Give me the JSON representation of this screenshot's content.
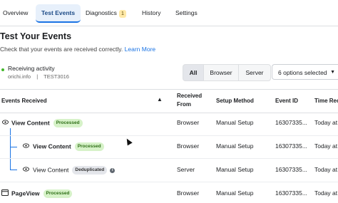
{
  "tabs": [
    {
      "label": "Overview"
    },
    {
      "label": "Test Events"
    },
    {
      "label": "Diagnostics",
      "badge": "1"
    },
    {
      "label": "History"
    },
    {
      "label": "Settings"
    }
  ],
  "page": {
    "title": "Test Your Events",
    "subtitle": "Check that your events are received correctly.",
    "learn_more": "Learn More"
  },
  "status": {
    "label": "Receiving activity",
    "domain": "orichi.info",
    "separator": "|",
    "test_code": "TEST3016"
  },
  "filters": {
    "segments": [
      "All",
      "Browser",
      "Server"
    ],
    "dropdown_label": "6 options selected",
    "dropdown_icon": "caret-down-icon"
  },
  "table": {
    "headers": {
      "events": "Events Received",
      "warning_icon": "▲",
      "received_from_1": "Received",
      "received_from_2": "From",
      "setup_method": "Setup Method",
      "event_id": "Event ID",
      "time": "Time Rece"
    },
    "rows": [
      {
        "name": "View Content",
        "status": "Processed",
        "from": "Browser",
        "method": "Manual Setup",
        "event_id": "16307335...",
        "time": "Today at"
      },
      {
        "name": "View Content",
        "status": "Processed",
        "from": "Browser",
        "method": "Manual Setup",
        "event_id": "16307335...",
        "time": "Today at"
      },
      {
        "name": "View Content",
        "status": "Deduplicated",
        "from": "Server",
        "method": "Manual Setup",
        "event_id": "16307335...",
        "time": "Today at"
      },
      {
        "name": "PageView",
        "status": "Processed",
        "from": "Browser",
        "method": "Manual Setup",
        "event_id": "16307335...",
        "time": "Today at"
      }
    ]
  },
  "colors": {
    "accent": "#1b74e4",
    "processed_bg": "#d6f2c8",
    "processed_text": "#2f6f17",
    "receiving_dot": "#42b72a"
  }
}
